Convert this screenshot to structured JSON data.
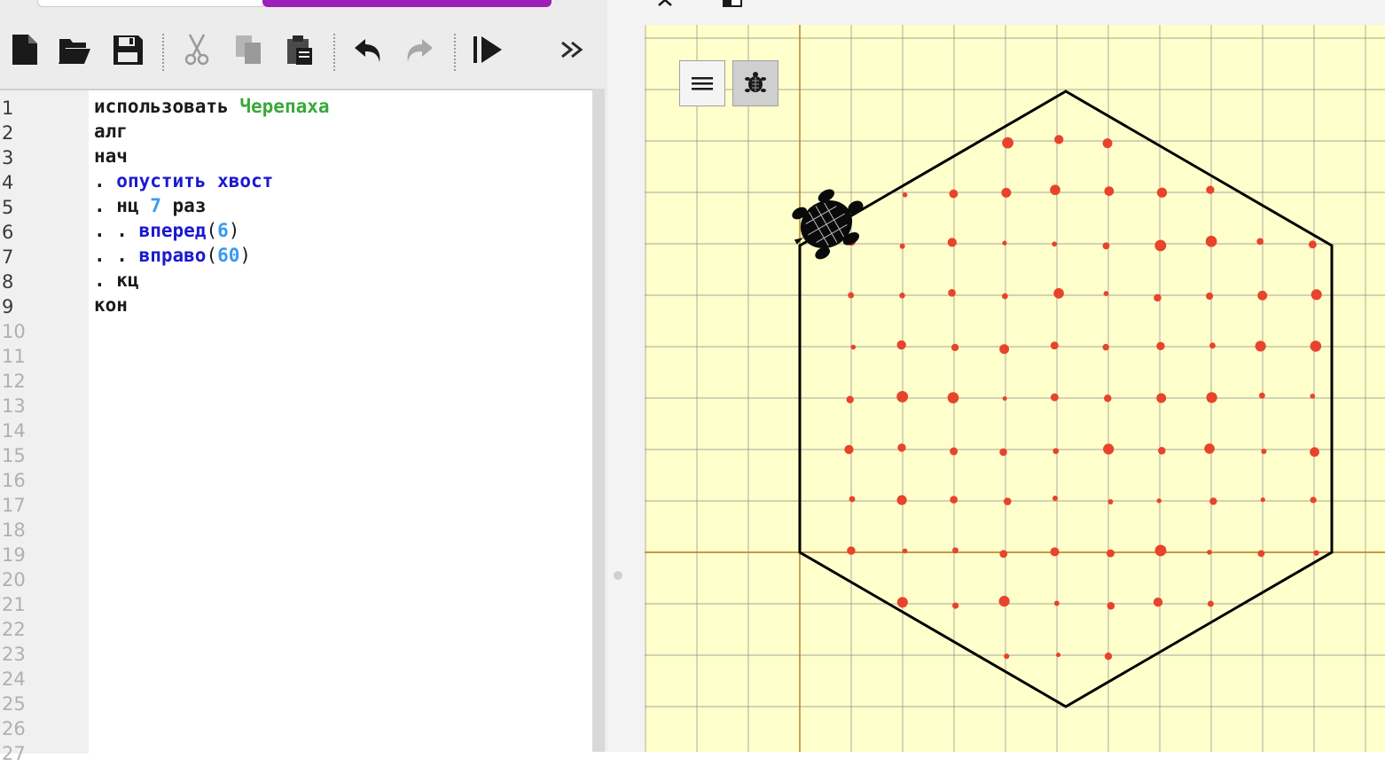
{
  "toolbar": {
    "buttons": [
      {
        "name": "new-file-button",
        "icon": "new-file-icon"
      },
      {
        "name": "open-file-button",
        "icon": "open-folder-icon"
      },
      {
        "name": "save-file-button",
        "icon": "floppy-disk-icon"
      },
      {
        "name": "cut-button",
        "icon": "scissors-icon"
      },
      {
        "name": "copy-button",
        "icon": "copy-icon"
      },
      {
        "name": "paste-button",
        "icon": "clipboard-icon"
      },
      {
        "name": "undo-button",
        "icon": "undo-arrow-icon"
      },
      {
        "name": "redo-button",
        "icon": "redo-arrow-icon"
      },
      {
        "name": "run-button",
        "icon": "run-play-icon"
      },
      {
        "name": "more-button",
        "icon": "double-chevron-right-icon"
      }
    ]
  },
  "editor": {
    "line_numbers": [
      "1",
      "2",
      "3",
      "4",
      "5",
      "6",
      "7",
      "8",
      "9",
      "10",
      "11",
      "12",
      "13",
      "14",
      "15",
      "16",
      "17",
      "18",
      "19",
      "20",
      "21",
      "22",
      "23",
      "24",
      "25",
      "26",
      "27"
    ],
    "code": {
      "l1_keyword": "использовать",
      "l1_module": "Черепаха",
      "l2": "алг",
      "l3": "нач",
      "l4_dot": ". ",
      "l4_cmd": "опустить хвост",
      "l5_dot": ". ",
      "l5_kw": "нц ",
      "l5_num": "7",
      "l5_kw2": " раз",
      "l6_dot": ". . ",
      "l6_cmd": "вперед",
      "l6_open": "(",
      "l6_num": "6",
      "l6_close": ")",
      "l7_dot": ". . ",
      "l7_cmd": "вправо",
      "l7_open": "(",
      "l7_num": "60",
      "l7_close": ")",
      "l8_dot": ". ",
      "l8_kw": "кц",
      "l9": "кон"
    }
  },
  "turtle_view": {
    "menu_icon": "hamburger-menu-icon",
    "turtle_toggle_icon": "turtle-icon",
    "close_icon": "close-icon",
    "window_icon": "window-icon",
    "colors": {
      "background": "#ffffcc",
      "grid": "#8a8a8a",
      "axis": "#b07a1a",
      "path": "#000000",
      "dots": "#e8432b"
    }
  }
}
